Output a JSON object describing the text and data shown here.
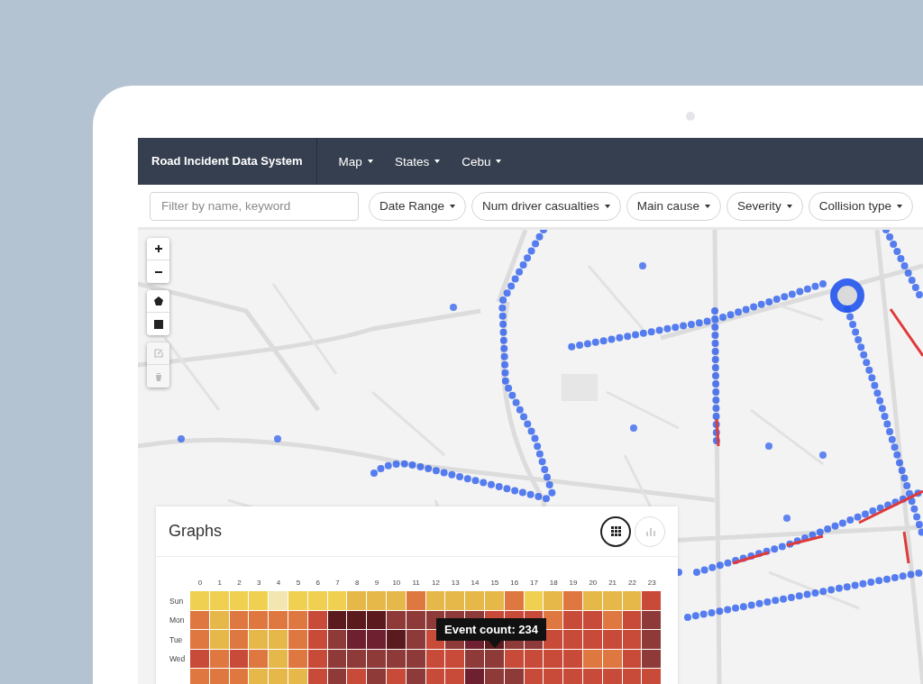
{
  "app": {
    "title": "Road Incident Data System",
    "menus": [
      {
        "label": "Map"
      },
      {
        "label": "States"
      },
      {
        "label": "Cebu"
      }
    ]
  },
  "filters": {
    "search": {
      "placeholder": "Filter by name, keyword"
    },
    "dropdowns": [
      {
        "label": "Date Range"
      },
      {
        "label": "Num driver casualties"
      },
      {
        "label": "Main cause"
      },
      {
        "label": "Severity"
      },
      {
        "label": "Collision type"
      }
    ]
  },
  "map": {
    "kind": "picture",
    "controls": [
      {
        "kind": "zoom-in",
        "disabled": false
      },
      {
        "kind": "zoom-out",
        "disabled": false
      },
      {
        "kind": "polygon",
        "disabled": false
      },
      {
        "kind": "rectangle",
        "disabled": false
      },
      {
        "kind": "edit",
        "disabled": true
      },
      {
        "kind": "delete",
        "disabled": true
      }
    ]
  },
  "graphs": {
    "title": "Graphs",
    "views": [
      {
        "kind": "grid",
        "selected": true
      },
      {
        "kind": "bar",
        "selected": false
      }
    ],
    "heatmap": {
      "hours": [
        "0",
        "1",
        "2",
        "3",
        "4",
        "5",
        "6",
        "7",
        "8",
        "9",
        "10",
        "11",
        "12",
        "13",
        "14",
        "15",
        "16",
        "17",
        "18",
        "19",
        "20",
        "21",
        "22",
        "23"
      ],
      "rows": [
        {
          "day": "Sun",
          "cells": [
            {
              "color": "#f0d050"
            },
            {
              "color": "#f0d050"
            },
            {
              "color": "#f0d050"
            },
            {
              "color": "#f0d050"
            },
            {
              "color": "#f3e6b0"
            },
            {
              "color": "#f0d050"
            },
            {
              "color": "#f0d050"
            },
            {
              "color": "#f0d050"
            },
            {
              "color": "#e6b84a"
            },
            {
              "color": "#e6b84a"
            },
            {
              "color": "#e6b84a"
            },
            {
              "color": "#df7840"
            },
            {
              "color": "#e6b84a"
            },
            {
              "color": "#e6b84a"
            },
            {
              "color": "#e6b84a"
            },
            {
              "color": "#e6b84a"
            },
            {
              "color": "#df7840"
            },
            {
              "color": "#f0d050"
            },
            {
              "color": "#e6b84a"
            },
            {
              "color": "#df7840"
            },
            {
              "color": "#e6b84a"
            },
            {
              "color": "#e6b84a"
            },
            {
              "color": "#e6b84a"
            },
            {
              "color": "#c84a38"
            }
          ]
        },
        {
          "day": "Mon",
          "cells": [
            {
              "color": "#df7840"
            },
            {
              "color": "#e6b84a"
            },
            {
              "color": "#df7840"
            },
            {
              "color": "#df7840"
            },
            {
              "color": "#df7840"
            },
            {
              "color": "#df7840"
            },
            {
              "color": "#c84a38"
            },
            {
              "color": "#5a1a1e"
            },
            {
              "color": "#5a1a1e"
            },
            {
              "color": "#5a1a1e"
            },
            {
              "color": "#8e3a38"
            },
            {
              "color": "#8e3a38"
            },
            {
              "color": "#8e3a38"
            },
            {
              "color": "#8e3a38"
            },
            {
              "color": "#8e3a38"
            },
            {
              "color": "#c84a38"
            },
            {
              "color": "#c84a38"
            },
            {
              "color": "#c84a38"
            },
            {
              "color": "#df7840"
            },
            {
              "color": "#c84a38"
            },
            {
              "color": "#c84a38"
            },
            {
              "color": "#df7840"
            },
            {
              "color": "#c84a38"
            },
            {
              "color": "#8e3a38"
            }
          ]
        },
        {
          "day": "Tue",
          "cells": [
            {
              "color": "#df7840"
            },
            {
              "color": "#e6b84a"
            },
            {
              "color": "#df7840"
            },
            {
              "color": "#e6b84a"
            },
            {
              "color": "#e6b84a"
            },
            {
              "color": "#df7840"
            },
            {
              "color": "#c84a38"
            },
            {
              "color": "#8e3a38"
            },
            {
              "color": "#6e2030"
            },
            {
              "color": "#6e2030"
            },
            {
              "color": "#5a1a1e"
            },
            {
              "color": "#8e3a38"
            },
            {
              "color": "#c84a38"
            },
            {
              "color": "#8e3a38"
            },
            {
              "color": "#6e2030"
            },
            {
              "color": "#5a1a1e"
            },
            {
              "color": "#8e3a38"
            },
            {
              "color": "#8e3a38"
            },
            {
              "color": "#c84a38"
            },
            {
              "color": "#c84a38"
            },
            {
              "color": "#c84a38"
            },
            {
              "color": "#c84a38"
            },
            {
              "color": "#c84a38"
            },
            {
              "color": "#8e3a38"
            }
          ]
        },
        {
          "day": "Wed",
          "cells": [
            {
              "color": "#c84a38"
            },
            {
              "color": "#df7840"
            },
            {
              "color": "#c84a38"
            },
            {
              "color": "#df7840"
            },
            {
              "color": "#e6b84a"
            },
            {
              "color": "#df7840"
            },
            {
              "color": "#c84a38"
            },
            {
              "color": "#8e3a38"
            },
            {
              "color": "#8e3a38"
            },
            {
              "color": "#8e3a38"
            },
            {
              "color": "#8e3a38"
            },
            {
              "color": "#8e3a38"
            },
            {
              "color": "#c84a38"
            },
            {
              "color": "#c84a38"
            },
            {
              "color": "#8e3a38"
            },
            {
              "color": "#8e3a38"
            },
            {
              "color": "#c84a38"
            },
            {
              "color": "#c84a38"
            },
            {
              "color": "#c84a38"
            },
            {
              "color": "#c84a38"
            },
            {
              "color": "#df7840"
            },
            {
              "color": "#df7840"
            },
            {
              "color": "#c84a38"
            },
            {
              "color": "#8e3a38"
            }
          ]
        },
        {
          "cells": [
            {
              "color": "#df7840"
            },
            {
              "color": "#df7840"
            },
            {
              "color": "#df7840"
            },
            {
              "color": "#e6b84a"
            },
            {
              "color": "#e6b84a"
            },
            {
              "color": "#e6b84a"
            },
            {
              "color": "#c84a38"
            },
            {
              "color": "#8e3a38"
            },
            {
              "color": "#c84a38"
            },
            {
              "color": "#8e3a38"
            },
            {
              "color": "#c84a38"
            },
            {
              "color": "#8e3a38"
            },
            {
              "color": "#c84a38"
            },
            {
              "color": "#c84a38"
            },
            {
              "color": "#6e2030"
            },
            {
              "color": "#8e3a38"
            },
            {
              "color": "#8e3a38"
            },
            {
              "color": "#c84a38"
            },
            {
              "color": "#c84a38"
            },
            {
              "color": "#c84a38"
            },
            {
              "color": "#c84a38"
            },
            {
              "color": "#c84a38"
            },
            {
              "color": "#c84a38"
            },
            {
              "color": "#c84a38"
            }
          ]
        }
      ]
    },
    "tooltip": "Event count: 234"
  }
}
